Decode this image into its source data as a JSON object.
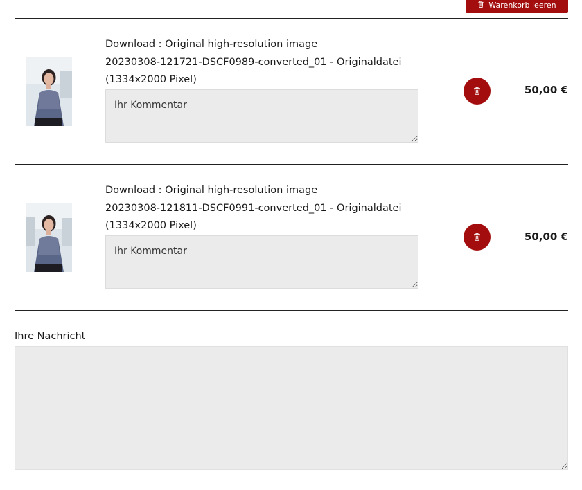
{
  "cart": {
    "clear_label": "Warenkorb leeren",
    "items": [
      {
        "desc_line1": "Download : Original high-resolution image",
        "desc_line2": "20230308-121721-DSCF0989-converted_01 - Originaldatei",
        "desc_line3": "(1334x2000 Pixel)",
        "comment_placeholder": "Ihr Kommentar",
        "price": "50,00 €"
      },
      {
        "desc_line1": "Download : Original high-resolution image",
        "desc_line2": "20230308-121811-DSCF0991-converted_01 - Originaldatei",
        "desc_line3": "(1334x2000 Pixel)",
        "comment_placeholder": "Ihr Kommentar",
        "price": "50,00 €"
      }
    ]
  },
  "message": {
    "label": "Ihre Nachricht",
    "value": ""
  },
  "colors": {
    "accent": "#a30d0d",
    "field_bg": "#ebebeb"
  },
  "icons": {
    "clear": "trash-icon",
    "delete": "trash-icon"
  }
}
